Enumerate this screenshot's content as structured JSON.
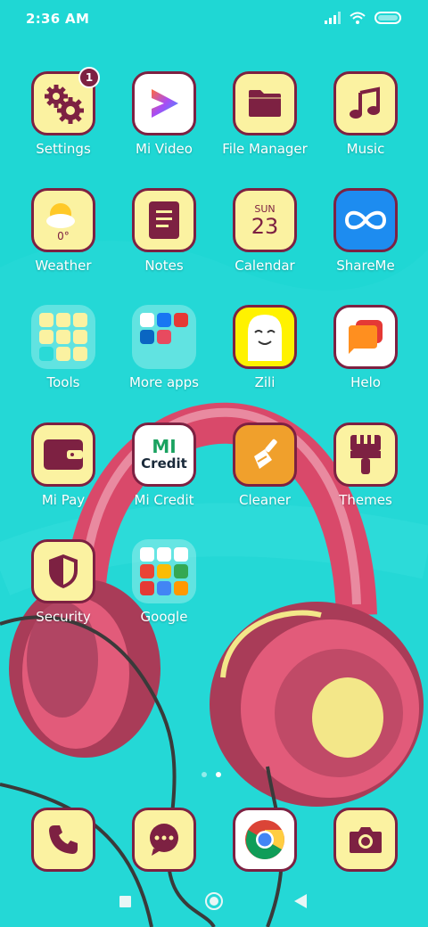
{
  "status_bar": {
    "time": "2:36 AM"
  },
  "apps": [
    {
      "id": "settings",
      "label": "Settings",
      "badge": "1"
    },
    {
      "id": "mi-video",
      "label": "Mi Video"
    },
    {
      "id": "file-manager",
      "label": "File Manager"
    },
    {
      "id": "music",
      "label": "Music"
    },
    {
      "id": "weather",
      "label": "Weather",
      "icon_text": "0°"
    },
    {
      "id": "notes",
      "label": "Notes"
    },
    {
      "id": "calendar",
      "label": "Calendar",
      "icon_day": "SUN",
      "icon_date": "23"
    },
    {
      "id": "shareme",
      "label": "ShareMe"
    },
    {
      "id": "tools",
      "label": "Tools"
    },
    {
      "id": "more-apps",
      "label": "More apps"
    },
    {
      "id": "zili",
      "label": "Zili"
    },
    {
      "id": "helo",
      "label": "Helo"
    },
    {
      "id": "mi-pay",
      "label": "Mi Pay"
    },
    {
      "id": "mi-credit",
      "label": "Mi Credit",
      "icon_mark": "MI",
      "icon_text": "Credit"
    },
    {
      "id": "cleaner",
      "label": "Cleaner"
    },
    {
      "id": "themes",
      "label": "Themes"
    },
    {
      "id": "security",
      "label": "Security"
    },
    {
      "id": "google",
      "label": "Google"
    }
  ],
  "dock": [
    "phone",
    "messages",
    "chrome",
    "camera"
  ],
  "page_indicator": {
    "pages": 2,
    "current": 2
  },
  "colors": {
    "background": "#1fd7d4",
    "icon_fill": "#fbf2a1",
    "icon_accent": "#7d2142"
  }
}
